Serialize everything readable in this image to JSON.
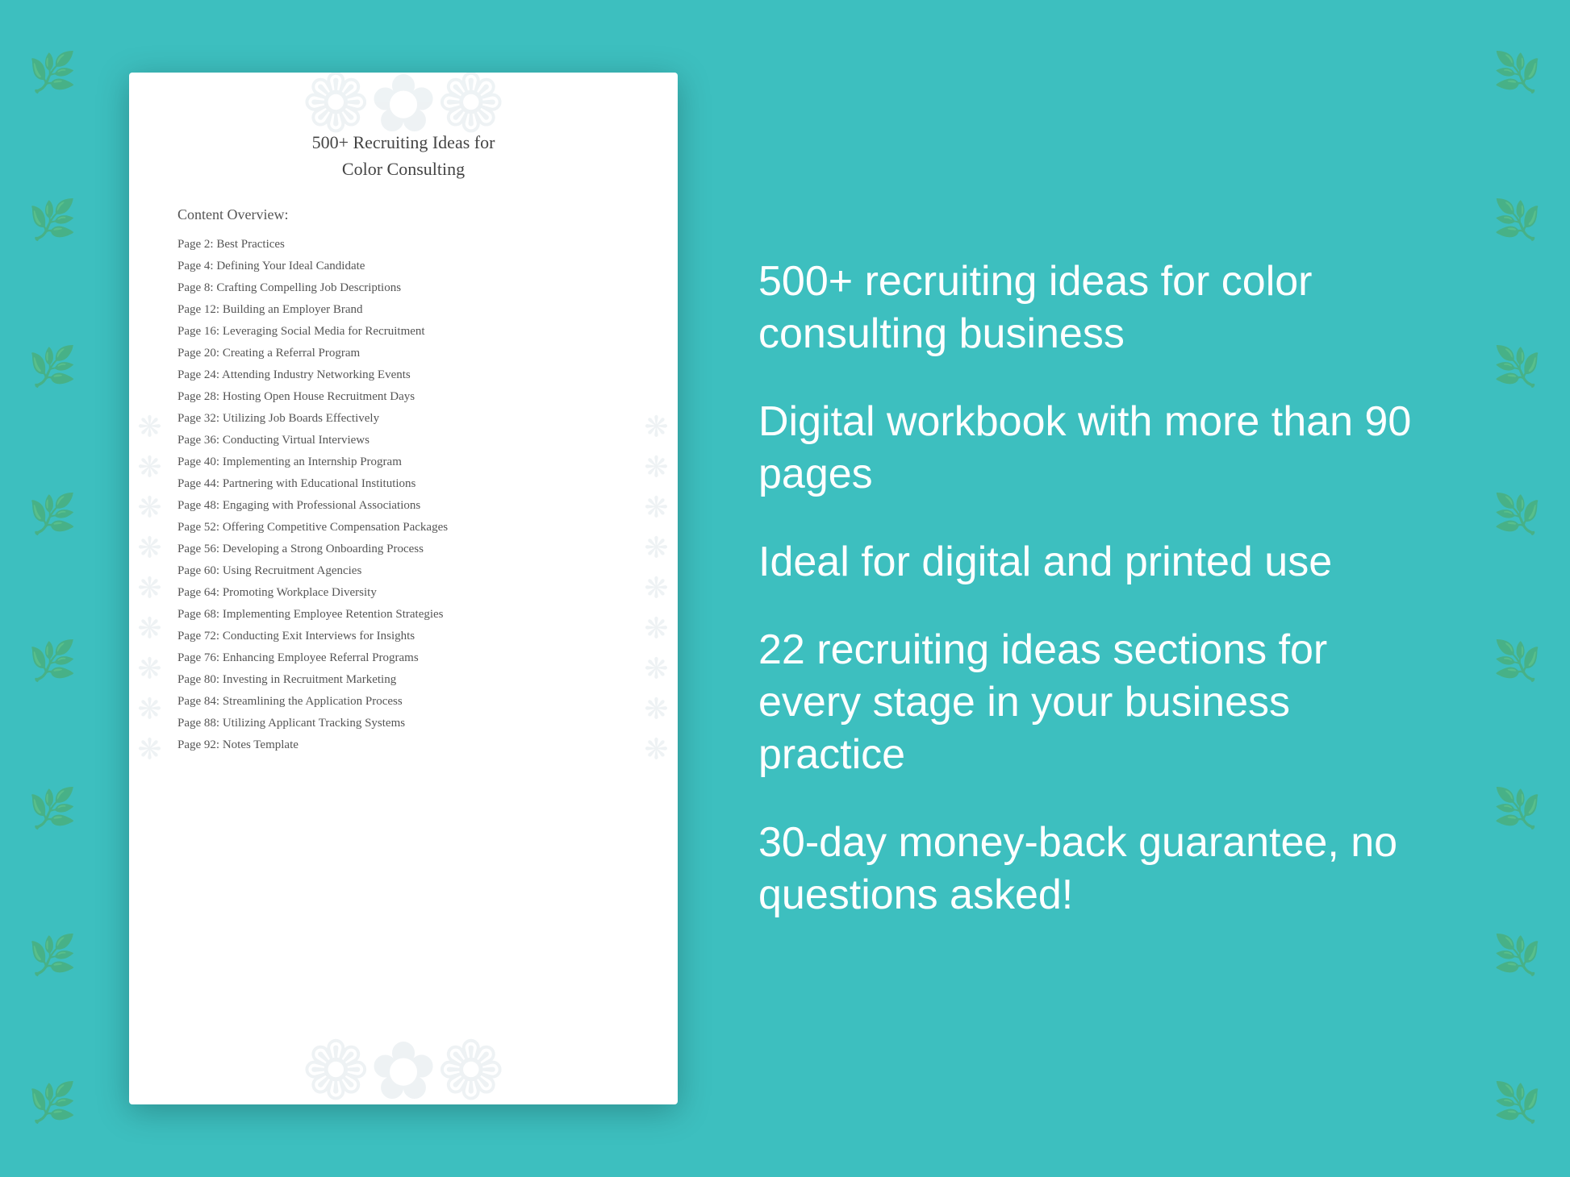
{
  "background_color": "#3dbfbf",
  "workbook": {
    "title_line1": "500+ Recruiting Ideas for",
    "title_line2": "Color Consulting",
    "content_label": "Content Overview:",
    "toc": [
      {
        "page": "Page  2:",
        "topic": "Best Practices"
      },
      {
        "page": "Page  4:",
        "topic": "Defining Your Ideal Candidate"
      },
      {
        "page": "Page  8:",
        "topic": "Crafting Compelling Job Descriptions"
      },
      {
        "page": "Page 12:",
        "topic": "Building an Employer Brand"
      },
      {
        "page": "Page 16:",
        "topic": "Leveraging Social Media for Recruitment"
      },
      {
        "page": "Page 20:",
        "topic": "Creating a Referral Program"
      },
      {
        "page": "Page 24:",
        "topic": "Attending Industry Networking Events"
      },
      {
        "page": "Page 28:",
        "topic": "Hosting Open House Recruitment Days"
      },
      {
        "page": "Page 32:",
        "topic": "Utilizing Job Boards Effectively"
      },
      {
        "page": "Page 36:",
        "topic": "Conducting Virtual Interviews"
      },
      {
        "page": "Page 40:",
        "topic": "Implementing an Internship Program"
      },
      {
        "page": "Page 44:",
        "topic": "Partnering with Educational Institutions"
      },
      {
        "page": "Page 48:",
        "topic": "Engaging with Professional Associations"
      },
      {
        "page": "Page 52:",
        "topic": "Offering Competitive Compensation Packages"
      },
      {
        "page": "Page 56:",
        "topic": "Developing a Strong Onboarding Process"
      },
      {
        "page": "Page 60:",
        "topic": "Using Recruitment Agencies"
      },
      {
        "page": "Page 64:",
        "topic": "Promoting Workplace Diversity"
      },
      {
        "page": "Page 68:",
        "topic": "Implementing Employee Retention Strategies"
      },
      {
        "page": "Page 72:",
        "topic": "Conducting Exit Interviews for Insights"
      },
      {
        "page": "Page 76:",
        "topic": "Enhancing Employee Referral Programs"
      },
      {
        "page": "Page 80:",
        "topic": "Investing in Recruitment Marketing"
      },
      {
        "page": "Page 84:",
        "topic": "Streamlining the Application Process"
      },
      {
        "page": "Page 88:",
        "topic": "Utilizing Applicant Tracking Systems"
      },
      {
        "page": "Page 92:",
        "topic": "Notes Template"
      }
    ]
  },
  "features": [
    "500+ recruiting ideas for color consulting business",
    "Digital workbook with more than 90 pages",
    "Ideal for digital and printed use",
    "22 recruiting ideas sections for every stage in your business practice",
    "30-day money-back guarantee, no questions asked!"
  ]
}
